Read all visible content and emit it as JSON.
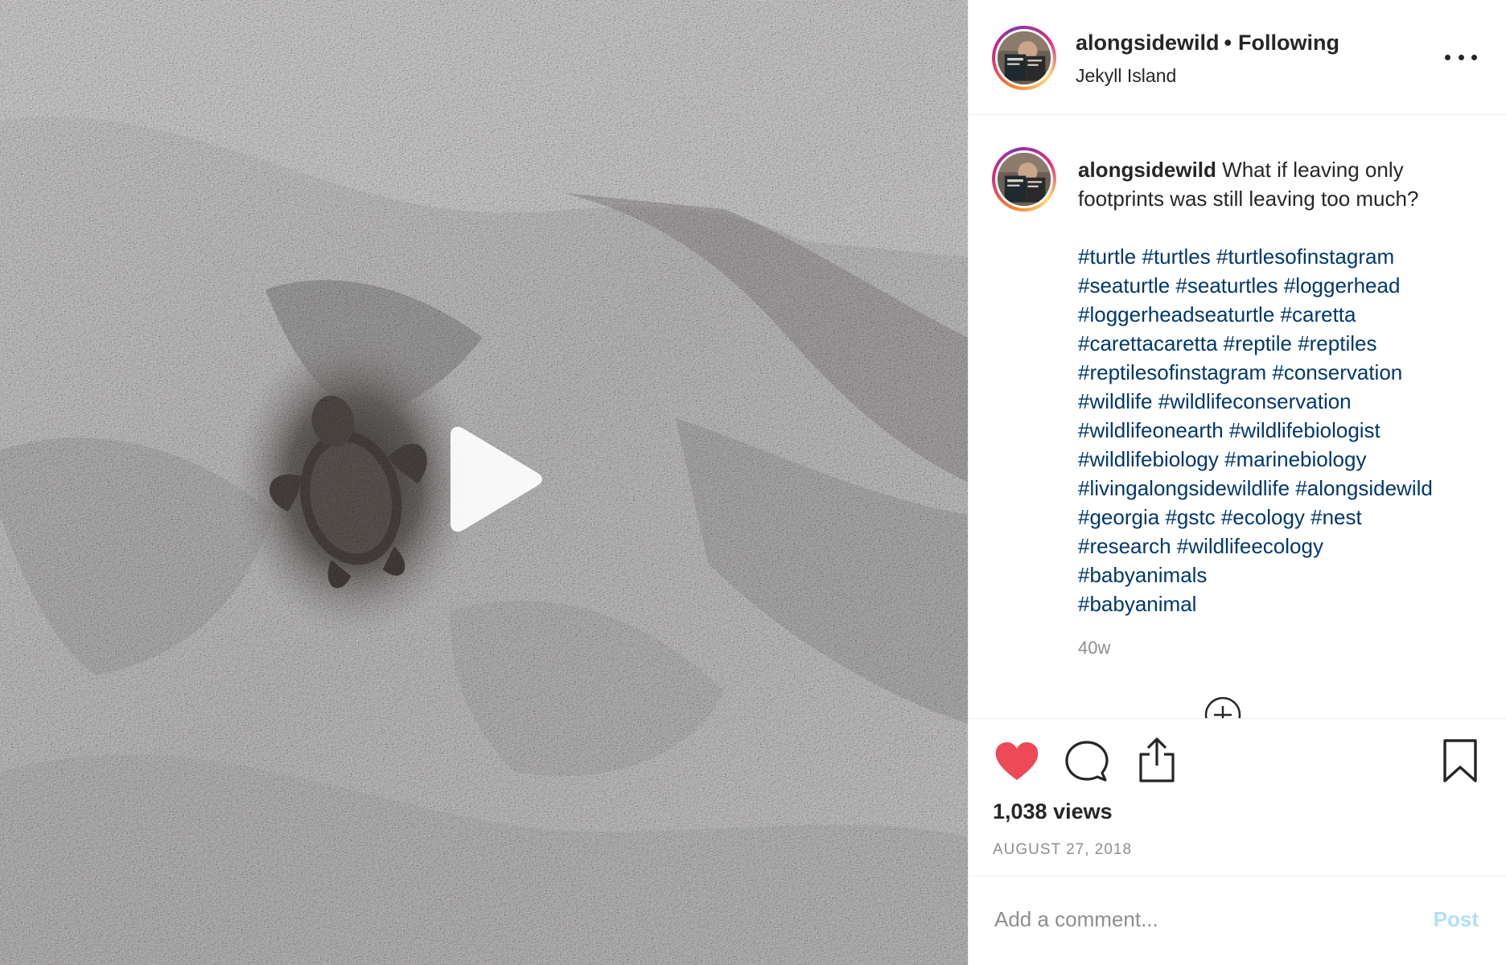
{
  "post": {
    "username": "alongsidewild",
    "separator": "•",
    "follow_status": "Following",
    "location": "Jekyll Island"
  },
  "caption": {
    "username": "alongsidewild",
    "text": "What if leaving only footprints was still leaving too much?",
    "hashtags": [
      "#turtle",
      "#turtles",
      "#turtlesofinstagram",
      "#seaturtle",
      "#seaturtles",
      "#loggerhead",
      "#loggerheadseaturtle",
      "#caretta",
      "#carettacaretta",
      "#reptile",
      "#reptiles",
      "#reptilesofinstagram",
      "#conservation",
      "#wildlife",
      "#wildlifeconservation",
      "#wildlifeonearth",
      "#wildlifebiologist",
      "#wildlifebiology",
      "#marinebiology",
      "#livingalongsidewildlife",
      "#alongsidewild",
      "#georgia",
      "#gstc",
      "#ecology",
      "#nest",
      "#research",
      "#wildlifeecology",
      "#babyanimals",
      "#babyanimal"
    ],
    "timestamp": "40w"
  },
  "stats": {
    "views": "1,038 views",
    "date": "AUGUST 27, 2018"
  },
  "comment": {
    "placeholder": "Add a comment...",
    "post_label": "Post"
  },
  "icons": {
    "more": "more-options-icon",
    "like": "heart-icon",
    "comment": "comment-bubble-icon",
    "share": "share-icon",
    "save": "bookmark-icon",
    "play": "play-icon",
    "load_more": "plus-circle-icon"
  },
  "colors": {
    "like_red": "#ed4956",
    "hashtag_blue": "#00376b",
    "muted_gray": "#8e8e8e",
    "post_button_disabled": "#b2dffc"
  },
  "media": {
    "liked": true
  }
}
